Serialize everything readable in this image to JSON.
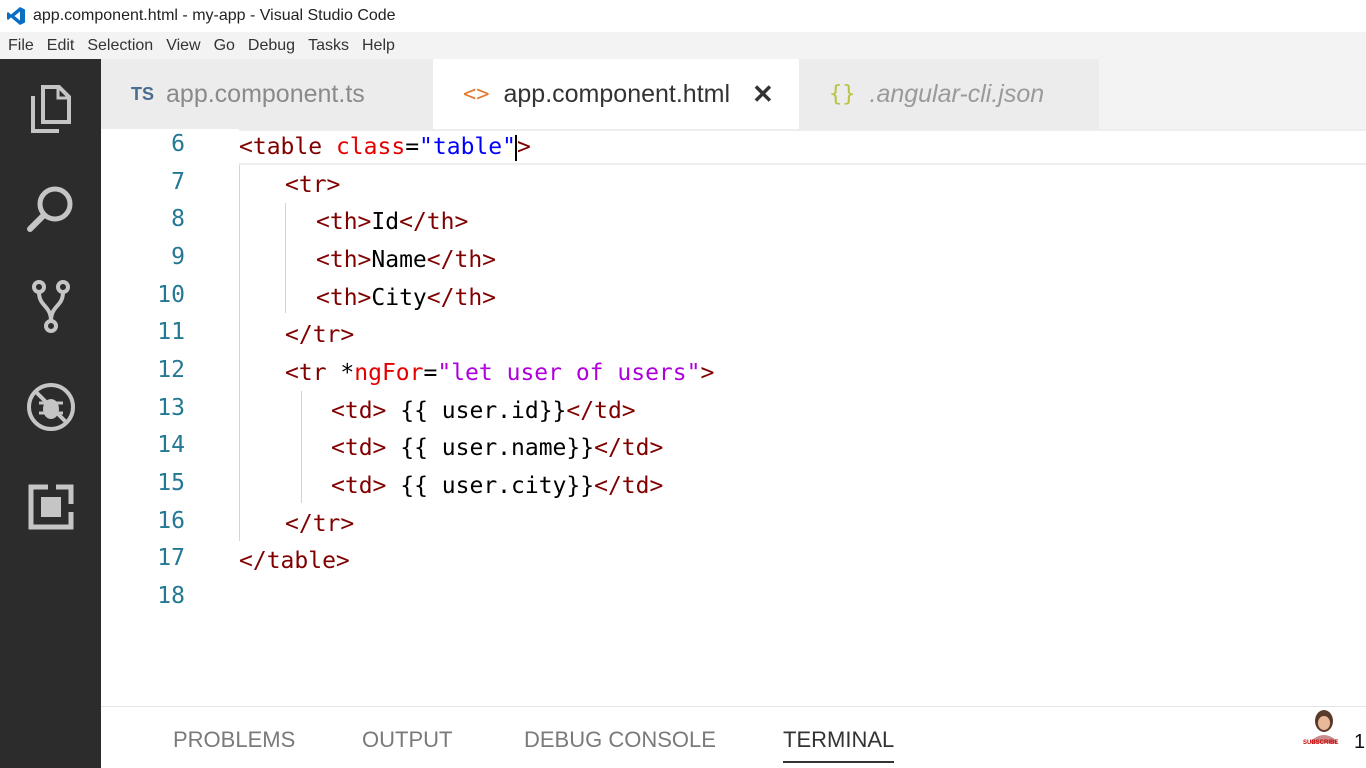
{
  "window": {
    "title": "app.component.html - my-app - Visual Studio Code"
  },
  "menu": [
    "File",
    "Edit",
    "Selection",
    "View",
    "Go",
    "Debug",
    "Tasks",
    "Help"
  ],
  "activity_bar": [
    {
      "icon": "explorer-icon"
    },
    {
      "icon": "search-icon"
    },
    {
      "icon": "source-control-icon"
    },
    {
      "icon": "debug-icon"
    },
    {
      "icon": "extensions-icon"
    }
  ],
  "tabs": [
    {
      "badge": "TS",
      "label": "app.component.ts",
      "active": false
    },
    {
      "badge": "<>",
      "label": "app.component.html",
      "active": true,
      "close": "✕"
    },
    {
      "badge": "{}",
      "label": ".angular-cli.json",
      "active": false
    }
  ],
  "editor": {
    "line_numbers": [
      "6",
      "7",
      "8",
      "9",
      "10",
      "11",
      "12",
      "13",
      "14",
      "15",
      "16",
      "17",
      "18"
    ],
    "code": {
      "l6": {
        "a": "<table",
        "b": " class",
        "c": "=",
        "d": "\"table\"",
        "e": ">"
      },
      "l7": "<tr>",
      "l8": {
        "a": "<th>",
        "b": "Id",
        "c": "</th>"
      },
      "l9": {
        "a": "<th>",
        "b": "Name",
        "c": "</th>"
      },
      "l10": {
        "a": "<th>",
        "b": "City",
        "c": "</th>"
      },
      "l11": "</tr>",
      "l12": {
        "a": "<tr",
        "b": " *",
        "c": "ngFor",
        "d": "=",
        "e": "\"let user of users\"",
        "f": ">"
      },
      "l13": {
        "a": "<td>",
        "b": " {{ user.id}}",
        "c": "</td>"
      },
      "l14": {
        "a": "<td>",
        "b": " {{ user.name}}",
        "c": "</td>"
      },
      "l15": {
        "a": "<td>",
        "b": " {{ user.city}}",
        "c": "</td>"
      },
      "l16": "</tr>",
      "l17": "</table>"
    }
  },
  "panel": {
    "tabs": [
      "PROBLEMS",
      "OUTPUT",
      "DEBUG CONSOLE",
      "TERMINAL"
    ],
    "active": "TERMINAL"
  },
  "overlay": {
    "subscribe_text": "SUBSCRIBE",
    "edge_glyph": "1"
  },
  "colors": {
    "activity_bar": "#2c2c2c",
    "line_number": "#237893",
    "tag": "#800000",
    "attribute": "#e50000",
    "string": "#0000ff"
  }
}
